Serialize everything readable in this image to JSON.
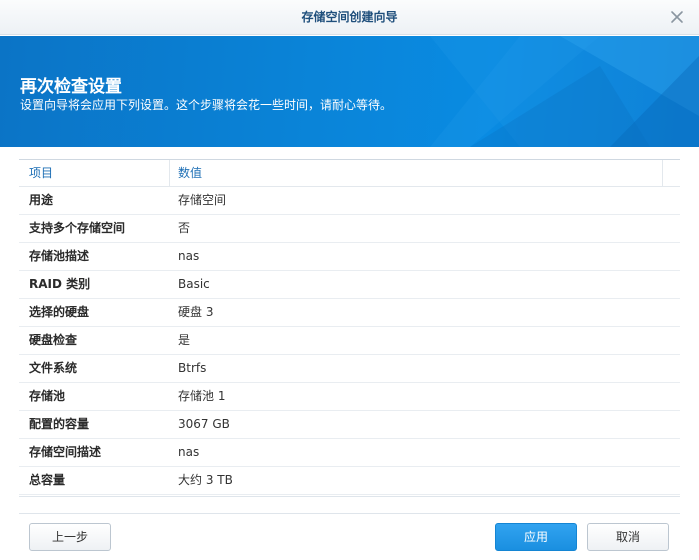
{
  "window": {
    "title": "存储空间创建向导",
    "close_icon": "close-icon"
  },
  "banner": {
    "title": "再次检查设置",
    "subtitle": "设置向导将会应用下列设置。这个步骤将会花一些时间，请耐心等待。",
    "accent": "#0a84d8"
  },
  "table": {
    "headers": [
      "项目",
      "数值"
    ],
    "rows": [
      {
        "key": "用途",
        "value": "存储空间"
      },
      {
        "key": "支持多个存储空间",
        "value": "否"
      },
      {
        "key": "存储池描述",
        "value": "nas"
      },
      {
        "key": "RAID 类别",
        "value": "Basic"
      },
      {
        "key": "选择的硬盘",
        "value": "硬盘 3"
      },
      {
        "key": "硬盘检查",
        "value": "是"
      },
      {
        "key": "文件系统",
        "value": "Btrfs"
      },
      {
        "key": "存储池",
        "value": "存储池 1"
      },
      {
        "key": "配置的容量",
        "value": "3067 GB"
      },
      {
        "key": "存储空间描述",
        "value": "nas"
      },
      {
        "key": "总容量",
        "value": "大约 3 TB"
      }
    ]
  },
  "buttons": {
    "prev": "上一步",
    "apply": "应用",
    "cancel": "取消"
  }
}
